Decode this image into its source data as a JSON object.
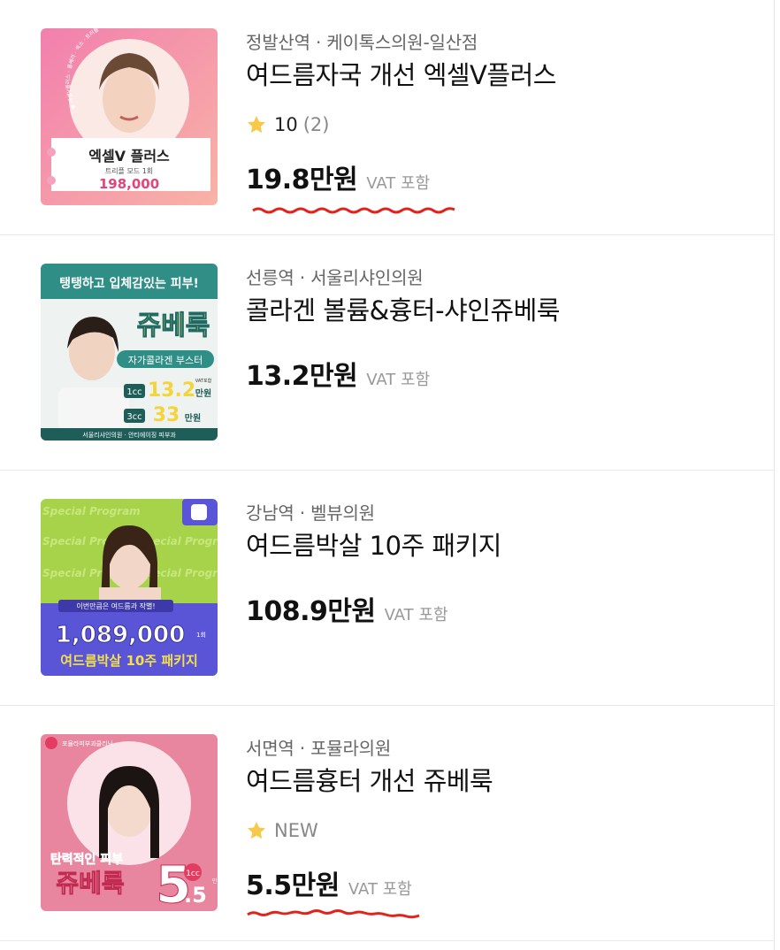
{
  "items": [
    {
      "location": "정발산역 · 케이톡스의원-일산점",
      "title": "여드름자국 개선 엑셀V플러스",
      "rating": "10",
      "review_count": "(2)",
      "price": "19.8만원",
      "vat": "VAT 포함",
      "thumb": {
        "arc_text": "♥ 엑셀V플러스 · 울쎄라 · 색소 · 트러블 · 여드름 자국 개선 ♥",
        "product": "엑셀V 플러스",
        "sub": "트리플 모드 1회",
        "price": "198,000"
      }
    },
    {
      "location": "선릉역 · 서울리샤인의원",
      "title": "콜라겐 볼륨&흉터-샤인쥬베룩",
      "price": "13.2만원",
      "vat": "VAT 포함",
      "thumb": {
        "headline": "탱탱하고 입체감있는 피부!",
        "product": "쥬베룩",
        "sub": "자가콜라겐 부스터",
        "opt1_unit": "1cc",
        "opt1_price": "13.2",
        "opt1_suffix": "만원",
        "opt2_unit": "3cc",
        "opt2_price": "33",
        "opt2_suffix": "만원",
        "vat_small": "VAT포함",
        "footer": "서울리샤인의원 · 안티에이징 피부과"
      }
    },
    {
      "location": "강남역 · 벨뷰의원",
      "title": "여드름박살 10주 패키지",
      "price": "108.9만원",
      "vat": "VAT 포함",
      "thumb": {
        "bg_text": "Special Program",
        "tagline": "이번만큼은 여드름과 작별!",
        "price": "1,089,000",
        "price_suffix": "1회",
        "product": "여드름박살 10주 패키지"
      }
    },
    {
      "location": "서면역 · 포뮬라의원",
      "title": "여드름흉터 개선 쥬베룩",
      "rating_new": "NEW",
      "price": "5.5만원",
      "vat": "VAT 포함",
      "thumb": {
        "brand": "포뮬라피부과클리닉",
        "tagline": "탄력적인 피부",
        "product": "쥬베룩",
        "price_big": "5",
        "price_small": ".5",
        "unit": "1cc",
        "suffix": "만원"
      }
    }
  ],
  "colors": {
    "star": "#f7c948",
    "underline": "#e0241b",
    "thumb1_bg": "#f08fb5",
    "thumb2_bg": "#2f8f86",
    "thumb3_bg": "#a6d34a",
    "thumb4_bg": "#e9869f"
  }
}
